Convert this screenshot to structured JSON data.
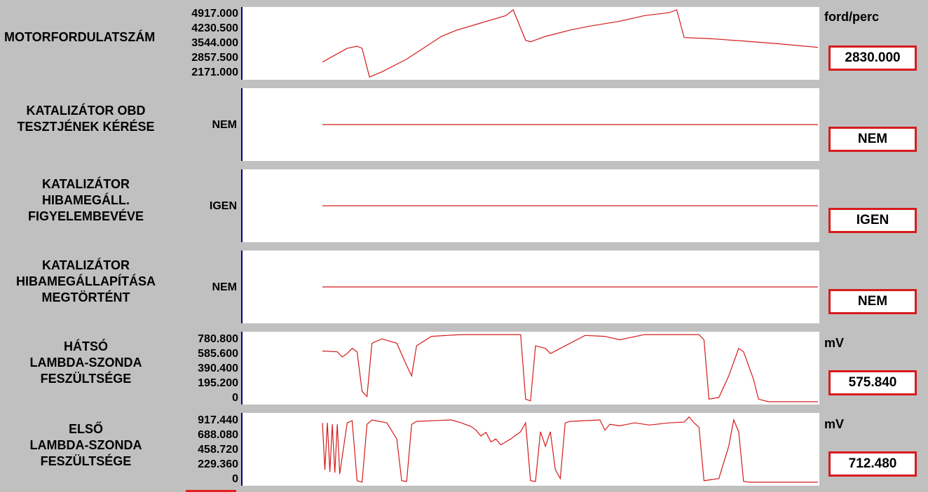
{
  "chart_data": [
    {
      "type": "line",
      "title": "MOTORFORDULATSZÁM",
      "unit": "ford/perc",
      "current_value": "2830.000",
      "y_ticks": [
        "4917.000",
        "4230.500",
        "3544.000",
        "2857.500",
        "2171.000"
      ],
      "ylim": [
        2171,
        4917
      ],
      "series": [
        {
          "points": [
            [
              0,
              2780
            ],
            [
              5,
              3340
            ],
            [
              7,
              3430
            ],
            [
              8,
              3340
            ],
            [
              9.5,
              2171
            ],
            [
              12,
              2380
            ],
            [
              17,
              2900
            ],
            [
              24,
              3830
            ],
            [
              27,
              4080
            ],
            [
              30,
              4260
            ],
            [
              37,
              4680
            ],
            [
              38.5,
              4917
            ],
            [
              41,
              3670
            ],
            [
              42,
              3610
            ],
            [
              45,
              3830
            ],
            [
              50,
              4090
            ],
            [
              54,
              4250
            ],
            [
              60,
              4450
            ],
            [
              65,
              4680
            ],
            [
              70,
              4800
            ],
            [
              71.5,
              4917
            ],
            [
              73,
              3780
            ],
            [
              78,
              3740
            ],
            [
              85,
              3640
            ],
            [
              92,
              3530
            ],
            [
              100,
              3380
            ]
          ]
        }
      ]
    },
    {
      "type": "line",
      "title": "KATALIZÁTOR OBD\nTESZTJÉNEK KÉRÉSE",
      "state_label": "NEM",
      "current_value": "NEM",
      "series": [
        {
          "points": [
            [
              0,
              0.5
            ],
            [
              100,
              0.5
            ]
          ]
        }
      ]
    },
    {
      "type": "line",
      "title": "KATALIZÁTOR\nHIBAMEGÁLL.\nFIGYELEMBEVÉVE",
      "state_label": "IGEN",
      "current_value": "IGEN",
      "series": [
        {
          "points": [
            [
              0,
              0.5
            ],
            [
              100,
              0.5
            ]
          ]
        }
      ]
    },
    {
      "type": "line",
      "title": "KATALIZÁTOR\nHIBAMEGÁLLAPÍTÁSA\nMEGTÖRTÉNT",
      "state_label": "NEM",
      "current_value": "NEM",
      "series": [
        {
          "points": [
            [
              0,
              0.5
            ],
            [
              100,
              0.5
            ]
          ]
        }
      ]
    },
    {
      "type": "line",
      "title": "HÁTSÓ\nLAMBDA-SZONDA\nFESZÜLTSÉGE",
      "unit": "mV",
      "current_value": "575.840",
      "y_ticks": [
        "780.800",
        "585.600",
        "390.400",
        "195.200",
        "0"
      ],
      "ylim": [
        0,
        780.8
      ],
      "series": [
        {
          "points": [
            [
              0,
              590
            ],
            [
              3,
              580
            ],
            [
              4,
              520
            ],
            [
              5,
              560
            ],
            [
              6,
              620
            ],
            [
              7,
              580
            ],
            [
              8,
              120
            ],
            [
              9,
              60
            ],
            [
              10,
              680
            ],
            [
              12,
              730
            ],
            [
              15,
              680
            ],
            [
              17,
              420
            ],
            [
              18,
              300
            ],
            [
              19,
              650
            ],
            [
              22,
              760
            ],
            [
              28,
              780
            ],
            [
              40,
              780
            ],
            [
              41,
              30
            ],
            [
              42,
              10
            ],
            [
              43,
              650
            ],
            [
              45,
              620
            ],
            [
              46,
              560
            ],
            [
              48,
              620
            ],
            [
              53,
              770
            ],
            [
              57,
              760
            ],
            [
              60,
              720
            ],
            [
              65,
              780
            ],
            [
              76,
              780
            ],
            [
              77,
              720
            ],
            [
              78,
              30
            ],
            [
              80,
              50
            ],
            [
              82,
              300
            ],
            [
              84,
              620
            ],
            [
              85,
              580
            ],
            [
              87,
              260
            ],
            [
              88,
              30
            ],
            [
              90,
              0
            ],
            [
              100,
              0
            ]
          ]
        }
      ]
    },
    {
      "type": "line",
      "title": "ELSŐ\nLAMBDA-SZONDA\nFESZÜLTSÉGE",
      "unit": "mV",
      "current_value": "712.480",
      "y_ticks": [
        "917.440",
        "688.080",
        "458.720",
        "229.360",
        "0"
      ],
      "ylim": [
        0,
        917.44
      ],
      "series": [
        {
          "points": [
            [
              0,
              820
            ],
            [
              0.5,
              180
            ],
            [
              1,
              820
            ],
            [
              1.5,
              150
            ],
            [
              2,
              800
            ],
            [
              2.5,
              140
            ],
            [
              3,
              800
            ],
            [
              3.5,
              120
            ],
            [
              5,
              820
            ],
            [
              6,
              850
            ],
            [
              7,
              30
            ],
            [
              8,
              10
            ],
            [
              9,
              800
            ],
            [
              10,
              860
            ],
            [
              13,
              820
            ],
            [
              15,
              600
            ],
            [
              16,
              30
            ],
            [
              17,
              20
            ],
            [
              18,
              800
            ],
            [
              19,
              840
            ],
            [
              26,
              860
            ],
            [
              28,
              820
            ],
            [
              30,
              770
            ],
            [
              31,
              720
            ],
            [
              32,
              640
            ],
            [
              33,
              690
            ],
            [
              34,
              560
            ],
            [
              35,
              600
            ],
            [
              36,
              520
            ],
            [
              37,
              560
            ],
            [
              38,
              600
            ],
            [
              39,
              650
            ],
            [
              40,
              700
            ],
            [
              41,
              820
            ],
            [
              42,
              30
            ],
            [
              43,
              20
            ],
            [
              44,
              700
            ],
            [
              45,
              500
            ],
            [
              46,
              700
            ],
            [
              47,
              180
            ],
            [
              48,
              60
            ],
            [
              49,
              820
            ],
            [
              50,
              840
            ],
            [
              56,
              860
            ],
            [
              57,
              720
            ],
            [
              58,
              800
            ],
            [
              60,
              780
            ],
            [
              63,
              820
            ],
            [
              66,
              790
            ],
            [
              70,
              820
            ],
            [
              73,
              830
            ],
            [
              74,
              900
            ],
            [
              75,
              820
            ],
            [
              76,
              760
            ],
            [
              77,
              30
            ],
            [
              79,
              50
            ],
            [
              80,
              60
            ],
            [
              82,
              500
            ],
            [
              83,
              860
            ],
            [
              84,
              700
            ],
            [
              85,
              20
            ],
            [
              86,
              10
            ],
            [
              100,
              10
            ]
          ]
        }
      ]
    }
  ]
}
